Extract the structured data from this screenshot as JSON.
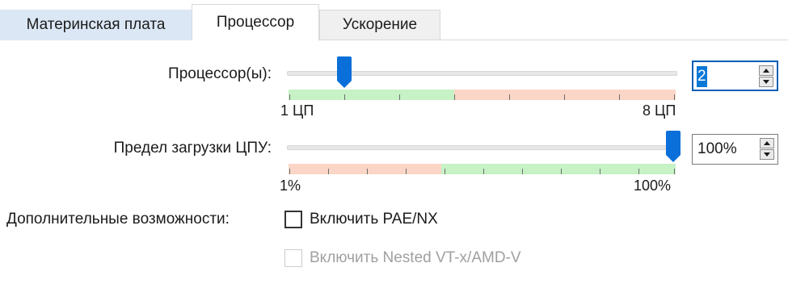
{
  "tabs": {
    "motherboard": "Материнская плата",
    "processor": "Процессор",
    "acceleration": "Ускорение",
    "active": "Процессор"
  },
  "cpu_count": {
    "label": "Процессор(ы):",
    "value": "2",
    "min": 1,
    "max": 8,
    "min_label": "1 ЦП",
    "max_label": "8 ЦП",
    "slider_fraction": 0.143
  },
  "cpu_cap": {
    "label": "Предел загрузки ЦПУ:",
    "value": "100%",
    "min": 1,
    "max": 100,
    "min_label": "1%",
    "max_label": "100%",
    "slider_fraction": 1.0
  },
  "extended_features": {
    "label": "Дополнительные возможности:",
    "pae_nx": {
      "label": "Включить PAE/NX",
      "checked": false,
      "enabled": true
    },
    "nested_vtx": {
      "label": "Включить Nested VT-x/AMD-V",
      "checked": false,
      "enabled": false
    }
  },
  "colors": {
    "accent": "#0a78d7",
    "thumb": "#0a6fd8",
    "safe_zone": "#c6f2c6",
    "warning_zone": "#fbd6c6",
    "active_tab_bg": "#ffffff",
    "selected_tab_bg": "#dbe7f5"
  },
  "icons": {
    "spin_up": "arrow-up-icon",
    "spin_down": "arrow-down-icon",
    "slider_thumb": "slider-thumb-icon"
  }
}
